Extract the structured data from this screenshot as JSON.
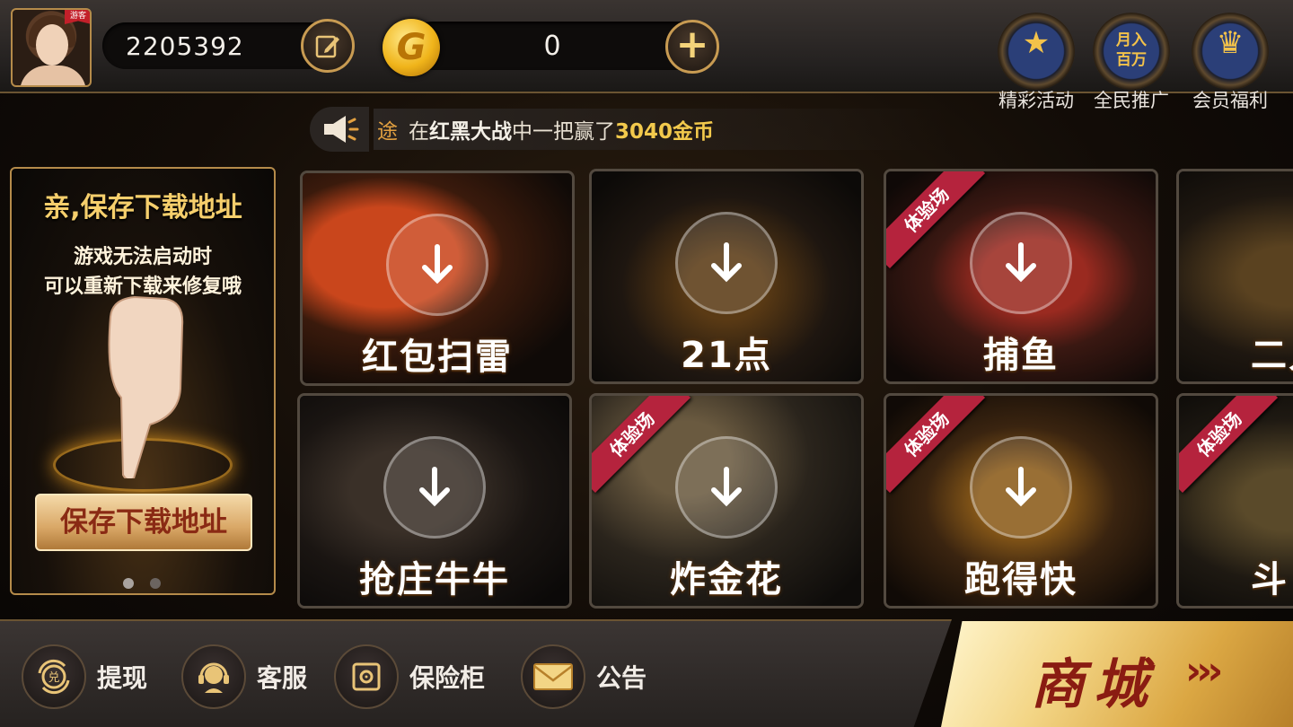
{
  "user": {
    "id": "2205392",
    "badge": "游客"
  },
  "coins": {
    "amount": "0",
    "symbol": "G"
  },
  "top_actions": [
    {
      "label": "精彩活动",
      "icon": "star-icon",
      "glyph": "★"
    },
    {
      "label": "全民推广",
      "icon": "promo-icon",
      "glyph": "月入百万"
    },
    {
      "label": "会员福利",
      "icon": "crown-icon",
      "glyph": "♛"
    }
  ],
  "marquee": {
    "who": "途",
    "text_a": "在",
    "game": "红黑大战",
    "text_b": "中一把赢了",
    "amount": "3040金币"
  },
  "promo": {
    "title": "亲,保存下载地址",
    "line1": "游戏无法启动时",
    "line2": "可以重新下载来修复哦",
    "button": "保存下载地址"
  },
  "games": [
    {
      "name": "红包扫雷",
      "trial": ""
    },
    {
      "name": "21点",
      "trial": ""
    },
    {
      "name": "捕鱼",
      "trial": "体验场"
    },
    {
      "name": "二人",
      "trial": ""
    },
    {
      "name": "抢庄牛牛",
      "trial": ""
    },
    {
      "name": "炸金花",
      "trial": "体验场"
    },
    {
      "name": "跑得快",
      "trial": "体验场"
    },
    {
      "name": "斗",
      "trial": "体验场"
    }
  ],
  "bottom_nav": [
    {
      "label": "提现",
      "icon": "exchange-icon"
    },
    {
      "label": "客服",
      "icon": "headset-icon"
    },
    {
      "label": "保险柜",
      "icon": "safe-icon"
    },
    {
      "label": "公告",
      "icon": "envelope-icon"
    }
  ],
  "shop": {
    "label": "商城",
    "arrows": "›››"
  },
  "colors": {
    "gold": "#c89b52",
    "accent_red": "#8a1c12",
    "ribbon": "#b5233d"
  }
}
